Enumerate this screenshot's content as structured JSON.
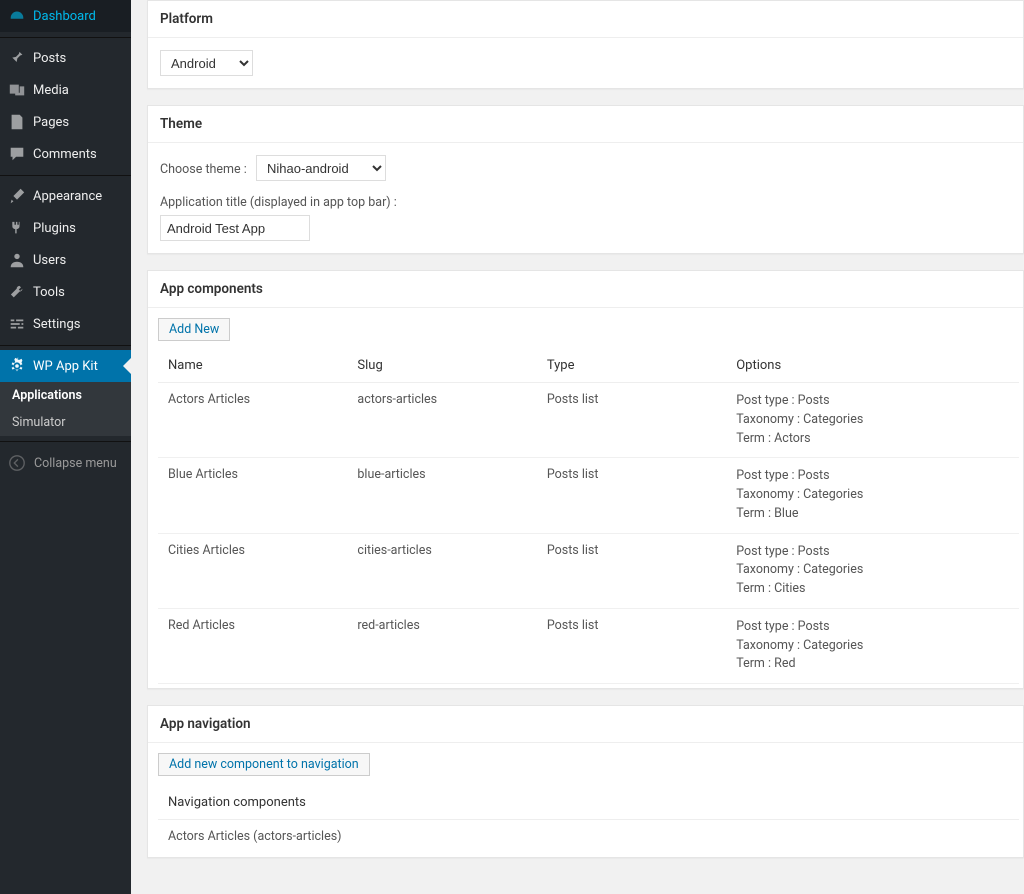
{
  "sidebar": {
    "items": [
      {
        "label": "Dashboard",
        "icon": "dashboard-icon"
      },
      {
        "label": "Posts",
        "icon": "pin-icon"
      },
      {
        "label": "Media",
        "icon": "media-icon"
      },
      {
        "label": "Pages",
        "icon": "pages-icon"
      },
      {
        "label": "Comments",
        "icon": "comments-icon"
      },
      {
        "label": "Appearance",
        "icon": "brush-icon"
      },
      {
        "label": "Plugins",
        "icon": "plug-icon"
      },
      {
        "label": "Users",
        "icon": "user-icon"
      },
      {
        "label": "Tools",
        "icon": "wrench-icon"
      },
      {
        "label": "Settings",
        "icon": "sliders-icon"
      },
      {
        "label": "WP App Kit",
        "icon": "gear-icon"
      }
    ],
    "sub": [
      {
        "label": "Applications"
      },
      {
        "label": "Simulator"
      }
    ],
    "collapse": "Collapse menu"
  },
  "platform_panel": {
    "title": "Platform",
    "value": "Android"
  },
  "theme_panel": {
    "title": "Theme",
    "choose_label": "Choose theme :",
    "theme_value": "Nihao-android",
    "app_title_label": "Application title (displayed in app top bar) :",
    "app_title_value": "Android Test App"
  },
  "components_panel": {
    "title": "App components",
    "add_new": "Add New",
    "headers": {
      "name": "Name",
      "slug": "Slug",
      "type": "Type",
      "options": "Options"
    },
    "rows": [
      {
        "name": "Actors Articles",
        "slug": "actors-articles",
        "type": "Posts list",
        "opt1": "Post type : Posts",
        "opt2": "Taxonomy : Categories",
        "opt3": "Term : Actors"
      },
      {
        "name": "Blue Articles",
        "slug": "blue-articles",
        "type": "Posts list",
        "opt1": "Post type : Posts",
        "opt2": "Taxonomy : Categories",
        "opt3": "Term : Blue"
      },
      {
        "name": "Cities Articles",
        "slug": "cities-articles",
        "type": "Posts list",
        "opt1": "Post type : Posts",
        "opt2": "Taxonomy : Categories",
        "opt3": "Term : Cities"
      },
      {
        "name": "Red Articles",
        "slug": "red-articles",
        "type": "Posts list",
        "opt1": "Post type : Posts",
        "opt2": "Taxonomy : Categories",
        "opt3": "Term : Red"
      }
    ]
  },
  "nav_panel": {
    "title": "App navigation",
    "add_new": "Add new component to navigation",
    "sub_header": "Navigation components",
    "item0": "Actors Articles (actors-articles)"
  }
}
